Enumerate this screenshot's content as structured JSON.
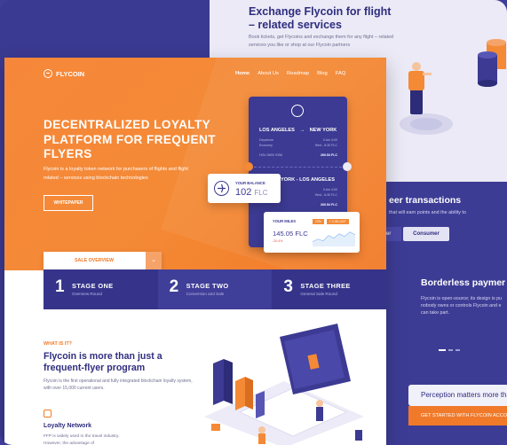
{
  "exchange_panel": {
    "title": "Exchange Flycoin for flight – related services",
    "description": "Book tickets, get Flycoins and exchange them for any flight – related services you like or shop at our Flycoin partners"
  },
  "peer_panel": {
    "title": "eer transactions",
    "description": "that will earn points and the ability to",
    "tab_left": "er",
    "tab_consumer": "Consumer",
    "borderless_title": "Borderless paymer",
    "borderless_description": "Flycoin is open-source; its design is pu nobody owns or controls Flycoin and e can take part."
  },
  "perception": "Perception matters more tha",
  "get_started": "GET STARTED WITH FLYCOIN ACCO",
  "site": {
    "logo": "FLYCOIN",
    "nav": [
      "Home",
      "About Us",
      "Roadmap",
      "Blog",
      "FAQ"
    ],
    "hero_title": "DECENTRALIZED LOYALTY PLATFORM FOR FREQUENT FLYERS",
    "hero_description": "Flycoin is a loyalty token network for purchasers of flights and flight related – services using blockchain technologies",
    "whitepaper": "WHITEPAPER",
    "ticket1": {
      "route_from": "LOS ANGELES",
      "route_to": "NEW YORK",
      "meta_left_1": "Departure",
      "meta_right_1": "0 Am 4:00",
      "meta_left_2": "Economy",
      "meta_right_2": "Wed - 6:30 FLC",
      "code": "HOU 5600 9356",
      "price": "260.54 FLC"
    },
    "ticket2": {
      "route": "YORK - LOS ANGELES",
      "meta_right_1": "0 Am 4:00",
      "meta_right_2": "Wed - 6:30 FLC",
      "price": "260.54 FLC"
    },
    "balance": {
      "label": "YOUR BALANCE",
      "value": "102",
      "unit": "FLC"
    },
    "miles": {
      "label": "YOUR MILES",
      "badge1": "23%",
      "badge2": "+ 2.05 LAST",
      "value": "145.05 FLC",
      "change": "-20.4%"
    },
    "sale_overview": "SALE OVERVIEW",
    "stages": [
      {
        "num": "1",
        "name": "STAGE ONE",
        "sub": "Overview Round"
      },
      {
        "num": "2",
        "name": "STAGE TWO",
        "sub": "Conversion and Sale"
      },
      {
        "num": "3",
        "name": "STAGE THREE",
        "sub": "General Sale Round"
      }
    ],
    "what_label": "WHAT IS IT?",
    "what_title": "Flycoin is more than just a frequent-flyer program",
    "what_description": "Flycoin is the first operational and fully integrated blockchain loyalty system, with over 15,000 current users.",
    "loyalty_title": "Loyalty Network",
    "loyalty_description": "FFP is widely used in the travel industry. However, the advantage of"
  },
  "colors": {
    "brand_orange": "#f48a36",
    "brand_purple": "#3c3a92",
    "light_panel": "#ebeaf6"
  }
}
